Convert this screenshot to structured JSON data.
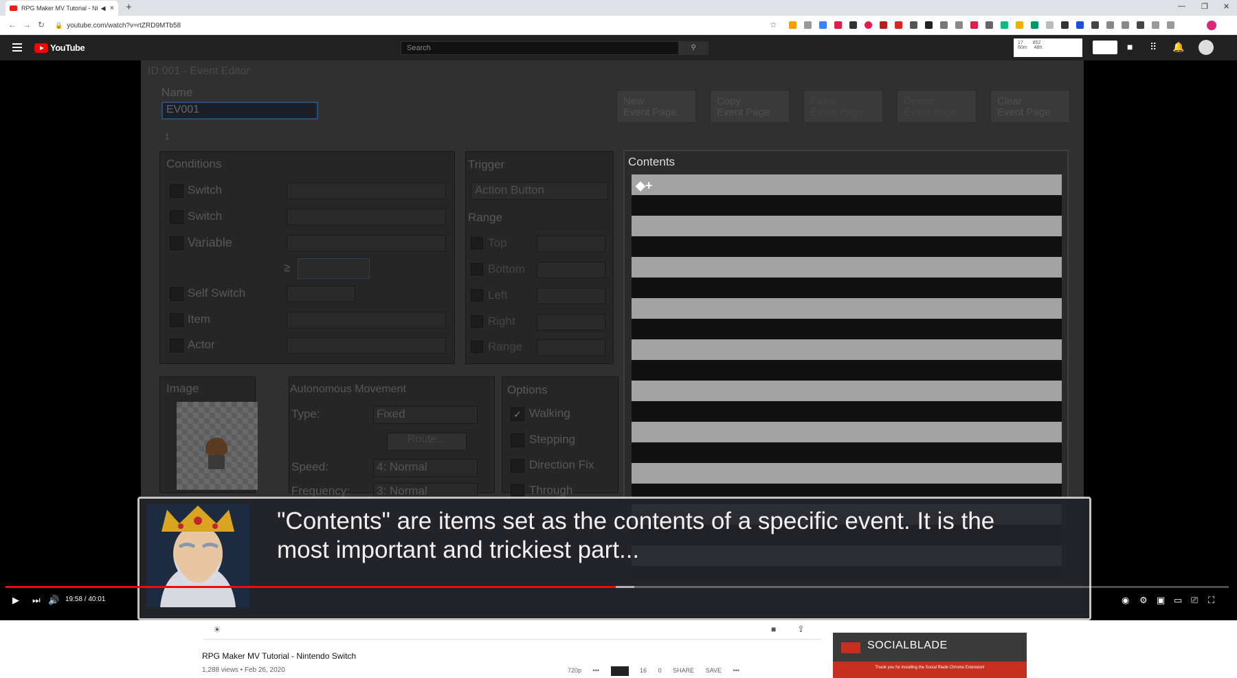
{
  "browser": {
    "tab_title": "RPG Maker MV Tutorial - Ni",
    "url": "youtube.com/watch?v=rtZRD9MTb58",
    "new_tab": "+"
  },
  "youtube": {
    "logo_text": "YouTube",
    "search_placeholder": "Search",
    "ext_stats": [
      "17",
      "852",
      "60m",
      "48h"
    ]
  },
  "editor": {
    "window_title": "ID:001 - Event Editor",
    "name_label": "Name",
    "name_value": "EV001",
    "page_tab": "1",
    "buttons": [
      "New\nEvent Page",
      "Copy\nEvent Page",
      "Paste\nEvent Page",
      "Delete\nEvent Page",
      "Clear\nEvent Page"
    ],
    "conditions_label": "Conditions",
    "conditions": [
      "Switch",
      "Switch",
      "Variable",
      "Self Switch",
      "Item",
      "Actor"
    ],
    "ge_symbol": "≥",
    "trigger_label": "Trigger",
    "trigger_value": "Action Button",
    "range_label": "Range",
    "range_items": [
      "Top",
      "Bottom",
      "Left",
      "Right",
      "Range"
    ],
    "image_label": "Image",
    "autonomous_label": "Autonomous Movement",
    "type_label": "Type:",
    "type_value": "Fixed",
    "route_btn": "Route...",
    "speed_label": "Speed:",
    "speed_value": "4: Normal",
    "freq_label": "Frequency:",
    "freq_value": "3: Normal",
    "options_label": "Options",
    "options": [
      "Walking",
      "Stepping",
      "Direction Fix",
      "Through"
    ],
    "contents_label": "Contents",
    "contents_first": "◆+"
  },
  "dialog": {
    "text": "\"Contents\" are items set as the contents of a specific event. It is the most important and trickiest part..."
  },
  "player": {
    "time": "19:58 / 40:01",
    "progress_fraction": 0.499,
    "buffer_fraction": 0.514
  },
  "video": {
    "title": "RPG Maker MV Tutorial - Nintendo Switch",
    "meta": "1,288 views • Feb 26, 2020",
    "quality": "720p",
    "likes": "16",
    "dislikes": "0",
    "share": "SHARE",
    "save": "SAVE"
  },
  "socialblade": {
    "title": "SOCIALBLADE",
    "message": "Thank you for installing the Social Blade Chrome Extension!"
  }
}
